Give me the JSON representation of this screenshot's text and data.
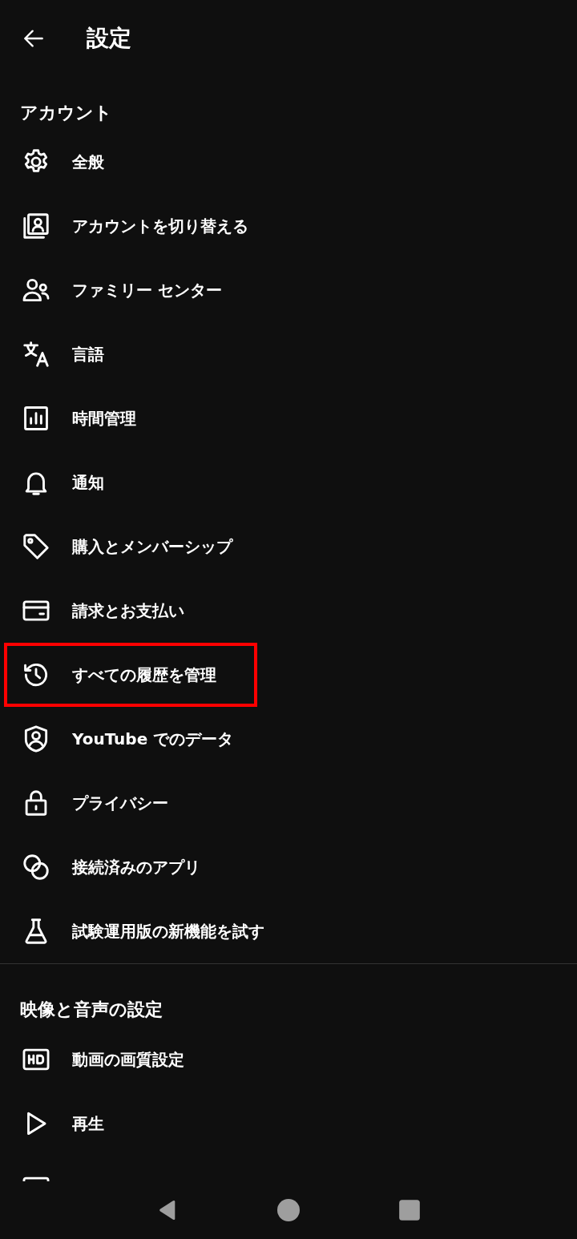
{
  "header": {
    "title": "設定"
  },
  "sections": [
    {
      "title": "アカウント",
      "items": [
        {
          "label": "全般",
          "highlighted": false
        },
        {
          "label": "アカウントを切り替える",
          "highlighted": false
        },
        {
          "label": "ファミリー センター",
          "highlighted": false
        },
        {
          "label": "言語",
          "highlighted": false
        },
        {
          "label": "時間管理",
          "highlighted": false
        },
        {
          "label": "通知",
          "highlighted": false
        },
        {
          "label": "購入とメンバーシップ",
          "highlighted": false
        },
        {
          "label": "請求とお支払い",
          "highlighted": false
        },
        {
          "label": "すべての履歴を管理",
          "highlighted": true
        },
        {
          "label": "**YouTube** でのデータ",
          "highlighted": false
        },
        {
          "label": "プライバシー",
          "highlighted": false
        },
        {
          "label": "接続済みのアプリ",
          "highlighted": false
        },
        {
          "label": "試験運用版の新機能を試す",
          "highlighted": false
        }
      ]
    },
    {
      "title": "映像と音声の設定",
      "items": [
        {
          "label": "動画の画質設定",
          "highlighted": false
        },
        {
          "label": "再生",
          "highlighted": false
        }
      ]
    }
  ]
}
